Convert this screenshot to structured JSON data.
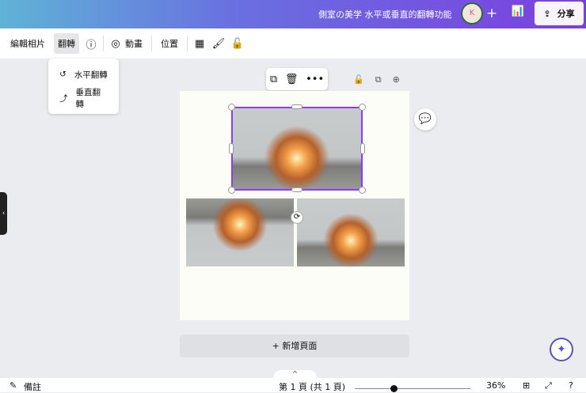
{
  "header": {
    "title": "側室の美学 水平或垂直的翻轉功能",
    "share_label": "分享",
    "avatar_text": "K"
  },
  "toolbar": {
    "edit_photo": "編輯相片",
    "flip": "翻轉",
    "animate": "動畫",
    "position": "位置"
  },
  "flip_menu": {
    "horizontal": "水平翻轉",
    "vertical": "垂直翻轉"
  },
  "canvas": {
    "add_page": "+ 新增頁面"
  },
  "footer": {
    "notes": "備註",
    "page_indicator": "第 1 頁 (共 1 頁)",
    "zoom": "36%",
    "zoom_value": 36
  }
}
